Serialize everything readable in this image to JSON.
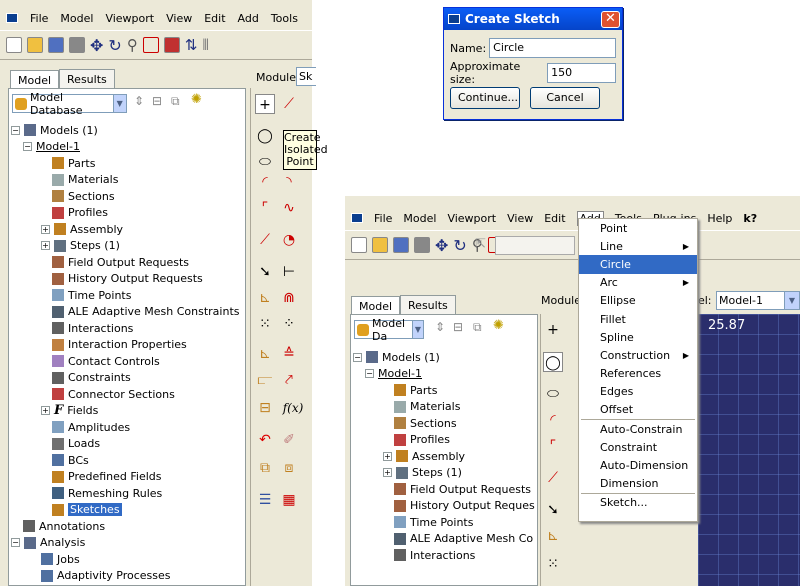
{
  "left_window": {
    "menu": [
      "File",
      "Model",
      "Viewport",
      "View",
      "Edit",
      "Add",
      "Tools"
    ],
    "tabs": [
      "Model",
      "Results"
    ],
    "module_label": "Module:",
    "module_value": "Sk",
    "model_db_combo": "Model Database",
    "tree": {
      "root": "Models (1)",
      "model": "Model-1",
      "items": [
        "Parts",
        "Materials",
        "Sections",
        "Profiles",
        "Assembly",
        "Steps (1)",
        "Field Output Requests",
        "History Output Requests",
        "Time Points",
        "ALE Adaptive Mesh Constraints",
        "Interactions",
        "Interaction Properties",
        "Contact Controls",
        "Constraints",
        "Connector Sections",
        "Fields",
        "Amplitudes",
        "Loads",
        "BCs",
        "Predefined Fields",
        "Remeshing Rules",
        "Sketches"
      ],
      "annotations": "Annotations",
      "analysis": "Analysis",
      "jobs": "Jobs",
      "adaptivity": "Adaptivity Processes"
    },
    "tooltip": "Create Isolated Point",
    "fx_label": "f(x)"
  },
  "dialog": {
    "title": "Create Sketch",
    "name_label": "Name:",
    "name_value": "Circle",
    "size_label": "Approximate size:",
    "size_value": "150",
    "continue_label": "Continue...",
    "cancel_label": "Cancel"
  },
  "right_window": {
    "menu": [
      "File",
      "Model",
      "Viewport",
      "View",
      "Edit",
      "Add",
      "Tools",
      "Plug-ins",
      "Help",
      "k?"
    ],
    "tabs": [
      "Model",
      "Results"
    ],
    "module_label": "Module",
    "model_label": "del:",
    "model_value": "Model-1",
    "model_db_combo": "Model Da",
    "coord_readout": "25.87",
    "tree": {
      "root": "Models (1)",
      "model": "Model-1",
      "items": [
        "Parts",
        "Materials",
        "Sections",
        "Profiles",
        "Assembly",
        "Steps (1)",
        "Field Output Requests",
        "History Output Reques",
        "Time Points",
        "ALE Adaptive Mesh Co",
        "Interactions"
      ]
    },
    "add_menu": [
      "Point",
      "Line",
      "Circle",
      "Arc",
      "Ellipse",
      "Fillet",
      "Spline",
      "Construction",
      "References",
      "Edges",
      "Offset",
      "Auto-Constrain",
      "Constraint",
      "Auto-Dimension",
      "Dimension",
      "Sketch..."
    ]
  },
  "colors": {
    "chrome": "#ece9d8",
    "highlight": "#316ac5",
    "viewport": "#2a2e6c",
    "titlebar": "#0a5df6"
  }
}
